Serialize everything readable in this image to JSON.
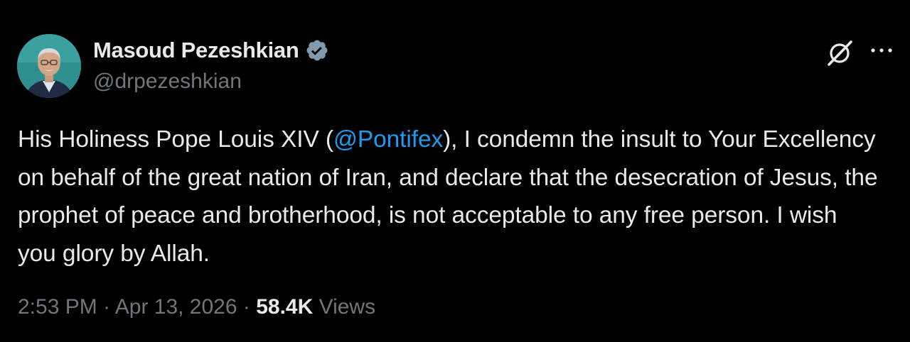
{
  "author": {
    "name": "Masoud Pezeshkian",
    "handle": "@drpezeshkian",
    "verified_icon": "verified-badge-icon",
    "avatar": "profile-photo"
  },
  "actions": {
    "grok_icon": "grok-icon",
    "more_icon": "more-options-icon"
  },
  "tweet": {
    "text_before": "His Holiness Pope Louis XIV (",
    "mention": "@Pontifex",
    "text_after": "), I condemn the insult to Your Excellency on behalf of the great nation of Iran, and declare that the desecration of Jesus, the prophet of peace and brotherhood, is not acceptable to any free person. I wish you glory by Allah."
  },
  "meta": {
    "time": "2:53 PM",
    "separator1": " · ",
    "date": "Apr 13, 2026",
    "separator2": " · ",
    "views_count": "58.4K",
    "views_label": " Views"
  },
  "colors": {
    "background": "#000000",
    "text_primary": "#e7e9ea",
    "text_secondary": "#71767b",
    "link": "#1d9bf0",
    "badge": "#829aab"
  }
}
